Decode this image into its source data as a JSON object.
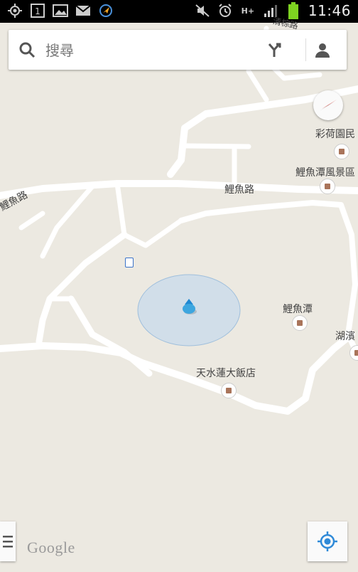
{
  "status_bar": {
    "time": "11:46",
    "sim_label": "1",
    "network": "H+",
    "left_icons": [
      "gps-icon",
      "sim-card-icon",
      "gallery-icon",
      "gmail-icon",
      "location-app-icon"
    ],
    "right_icons": [
      "mute-icon",
      "alarm-icon",
      "network-type-icon",
      "signal-icon",
      "battery-icon"
    ],
    "battery_color": "#7ed321"
  },
  "search": {
    "placeholder": "搜尋",
    "value": ""
  },
  "map": {
    "labels": {
      "road_top": "清棕路",
      "road_main": "鯉魚路",
      "road_left": "鯉魚路",
      "poi_lotus": "彩荷園民",
      "poi_park": "鯉魚潭風景區",
      "poi_lake": "鯉魚潭",
      "poi_hotel": "天水蓮大飯店",
      "poi_right": "湖濱"
    },
    "colors": {
      "background": "#ece9e1",
      "road": "#ffffff",
      "accuracy_circle": "#c3d9ec",
      "location_dot": "#3da6df",
      "compass_red": "#d9342b"
    }
  },
  "attribution": "Google"
}
